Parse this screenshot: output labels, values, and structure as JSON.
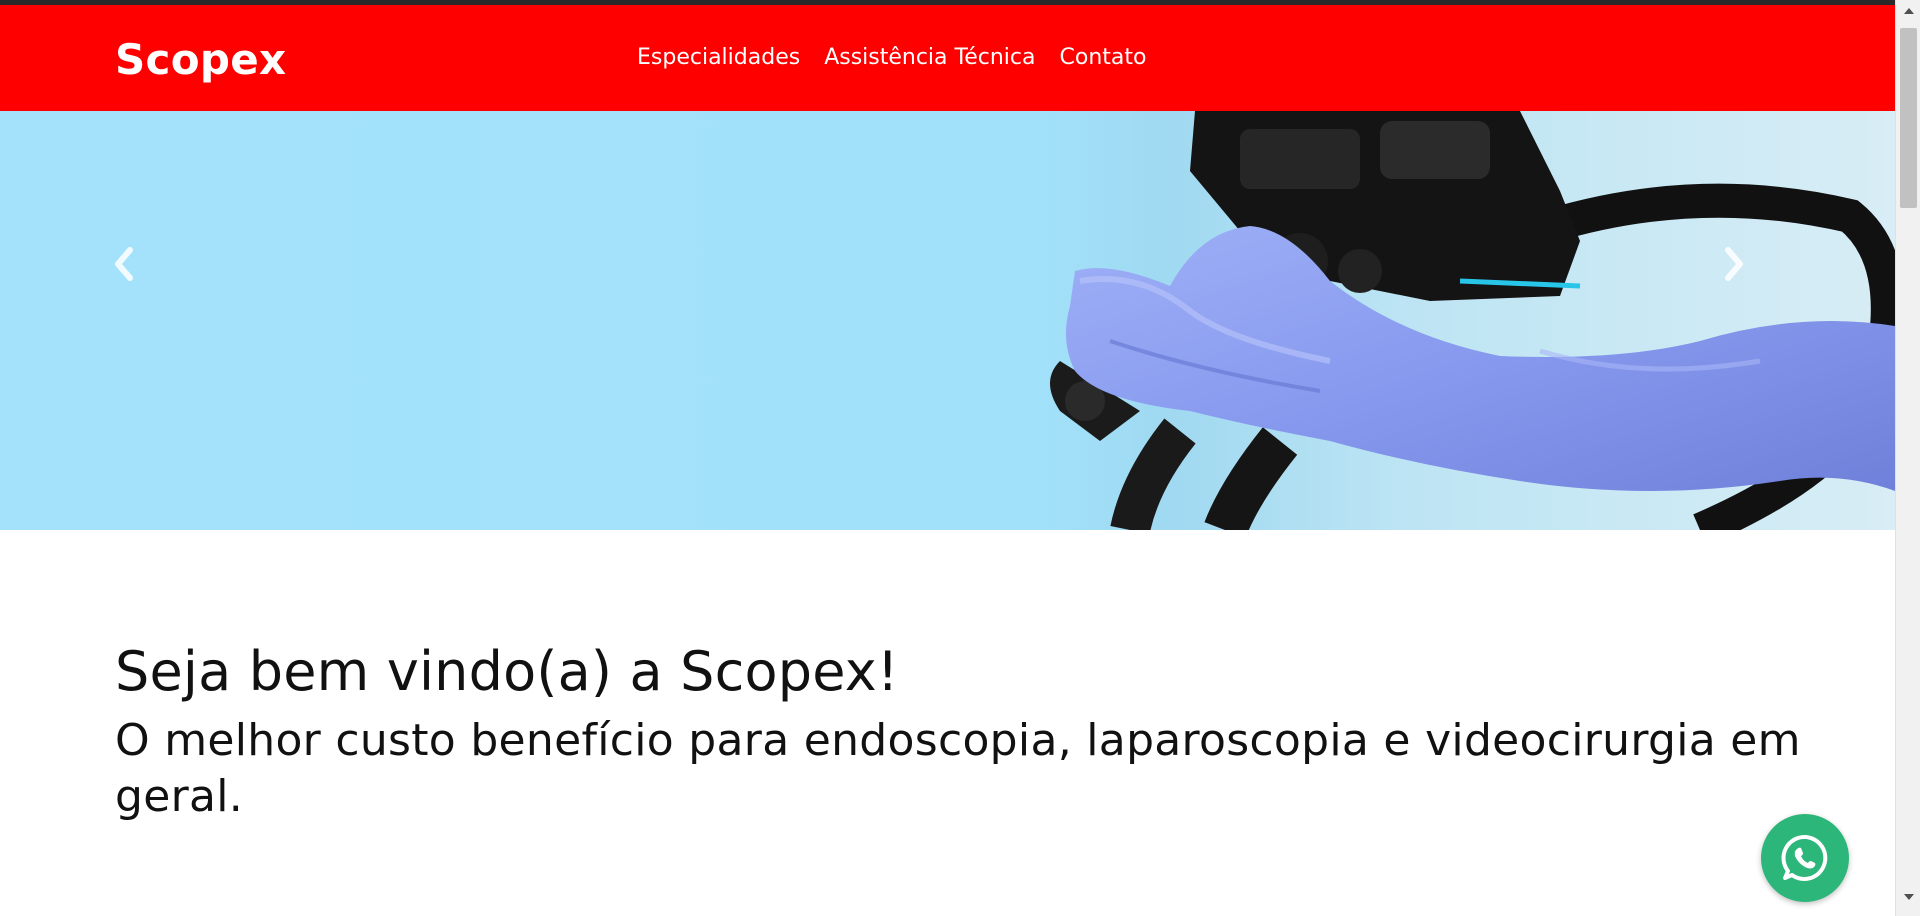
{
  "brand": {
    "name": "Scopex"
  },
  "nav": {
    "items": [
      {
        "label": "Especialidades"
      },
      {
        "label": "Assistência Técnica"
      },
      {
        "label": "Contato"
      }
    ]
  },
  "hero": {
    "prev_icon": "chevron-left-icon",
    "next_icon": "chevron-right-icon"
  },
  "welcome": {
    "title": "Seja bem vindo(a) a Scopex!",
    "subtitle": "O melhor custo benefício para endoscopia, laparoscopia e videocirurgia em geral."
  },
  "floating": {
    "icon": "whatsapp-icon"
  },
  "colors": {
    "navbar": "#ff0000",
    "hero_sky": "#a4e2fb",
    "glove": "#8a9ef0",
    "whatsapp": "#2cb67a"
  }
}
